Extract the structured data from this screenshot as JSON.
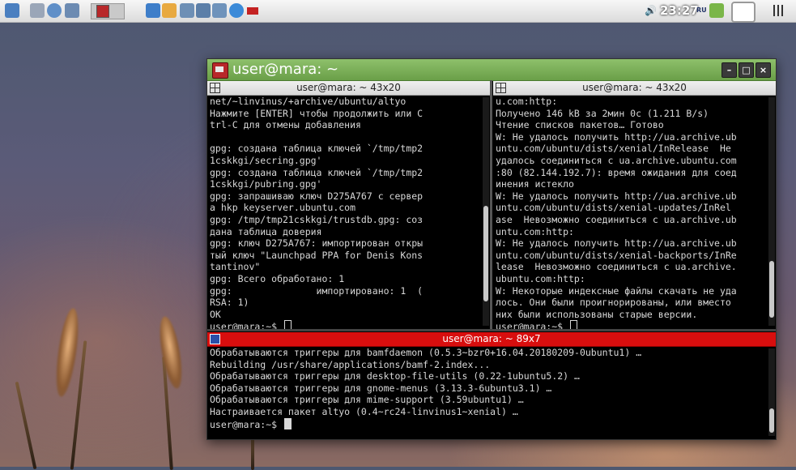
{
  "panel": {
    "clock": "23:27",
    "keyboard_layout": "RU"
  },
  "window": {
    "title": "user@mara: ~",
    "buttons": {
      "minimize": "–",
      "maximize": "□",
      "close": "×"
    }
  },
  "terminals": {
    "left": {
      "title": "user@mara: ~ 43x20",
      "lines": [
        "net/~linvinus/+archive/ubuntu/altyo",
        "Нажмите [ENTER] чтобы продолжить или C",
        "trl-C для отмены добавления",
        "",
        "gpg: создана таблица ключей `/tmp/tmp2",
        "1cskkgi/secring.gpg'",
        "gpg: создана таблица ключей `/tmp/tmp2",
        "1cskkgi/pubring.gpg'",
        "gpg: запрашиваю ключ D275A767 с сервер",
        "а hkp keyserver.ubuntu.com",
        "gpg: /tmp/tmp21cskkgi/trustdb.gpg: соз",
        "дана таблица доверия",
        "gpg: ключ D275A767: импортирован откры",
        "тый ключ \"Launchpad PPA for Denis Kons",
        "tantinov\"",
        "gpg: Всего обработано: 1",
        "gpg:               импортировано: 1  (",
        "RSA: 1)",
        "OK"
      ],
      "prompt": "user@mara:~$ "
    },
    "right": {
      "title": "user@mara: ~ 43x20",
      "lines": [
        "u.com:http:",
        "Получено 146 kB за 2мин 0с (1.211 B/s)",
        "Чтение списков пакетов… Готово",
        "W: Не удалось получить http://ua.archive.ub",
        "untu.com/ubuntu/dists/xenial/InRelease  Не",
        "удалось соединиться с ua.archive.ubuntu.com",
        ":80 (82.144.192.7): время ожидания для соед",
        "инения истекло",
        "W: Не удалось получить http://ua.archive.ub",
        "untu.com/ubuntu/dists/xenial-updates/InRel",
        "ase  Невозможно соединиться с ua.archive.ub",
        "untu.com:http:",
        "W: Не удалось получить http://ua.archive.ub",
        "untu.com/ubuntu/dists/xenial-backports/InRe",
        "lease  Невозможно соединиться с ua.archive.",
        "ubuntu.com:http:",
        "W: Некоторые индексные файлы скачать не уда",
        "лось. Они были проигнорированы, или вместо",
        "них были использованы старые версии."
      ],
      "prompt": "user@mara:~$ "
    },
    "bottom": {
      "title": "user@mara: ~ 89x7",
      "lines": [
        "Обрабатываются триггеры для bamfdaemon (0.5.3~bzr0+16.04.20180209-0ubuntu1) …",
        "Rebuilding /usr/share/applications/bamf-2.index...",
        "Обрабатываются триггеры для desktop-file-utils (0.22-1ubuntu5.2) …",
        "Обрабатываются триггеры для gnome-menus (3.13.3-6ubuntu3.1) …",
        "Обрабатываются триггеры для mime-support (3.59ubuntu1) …",
        "Настраивается пакет altyo (0.4~rc24-linvinus1~xenial) …"
      ],
      "prompt": "user@mara:~$ "
    }
  },
  "icons": {
    "panel_left": [
      "dash-icon",
      "home-folder-icon",
      "browser-icon",
      "desktop-icon",
      "altyo-icon"
    ],
    "panel_launchers": [
      "image-icon",
      "paint-icon",
      "document-icon",
      "text-icon",
      "spreadsheet-icon",
      "chrome-icon",
      "flag-icon"
    ],
    "panel_right": [
      "volume-icon",
      "dropbox-icon",
      "network-icon"
    ]
  }
}
